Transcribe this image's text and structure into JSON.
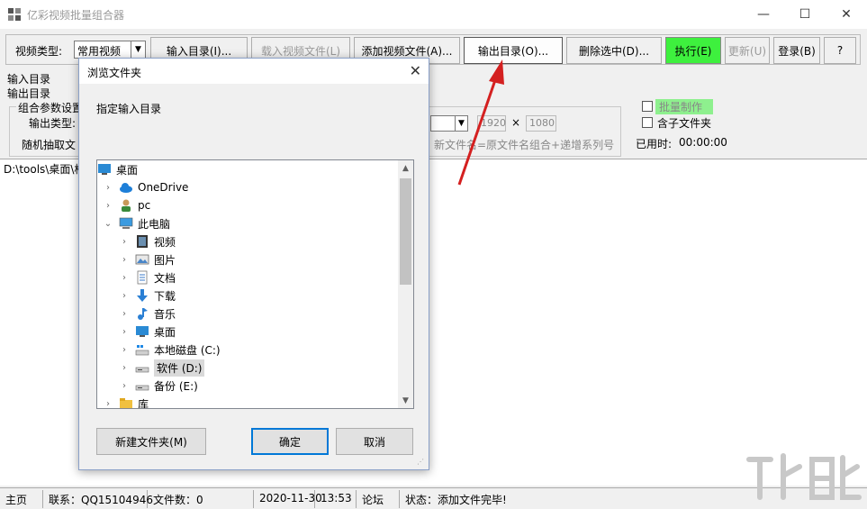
{
  "window": {
    "title": "亿彩视频批量组合器",
    "controls": {
      "minimize": "—",
      "maximize": "☐",
      "close": "✕"
    }
  },
  "toolbar": {
    "video_type_label": "视频类型:",
    "video_type_value": "常用视频",
    "buttons": {
      "input_dir": "输入目录(I)...",
      "load_files": "载入视频文件(L)",
      "add_files": "添加视频文件(A)...",
      "output_dir": "输出目录(O)...",
      "delete_selected": "删除选中(D)...",
      "execute": "执行(E)",
      "update": "更新(U)",
      "login": "登录(B)",
      "help": "?"
    }
  },
  "form": {
    "input_dir_label": "输入目录",
    "output_dir_label": "输出目录",
    "group_label": "组合参数设置",
    "output_type_label": "输出类型:",
    "random_label": "随机抽取文",
    "width": "1920",
    "times": "×",
    "height": "1080",
    "naming_hint": "新文件名=原文件名组合+递增系列号",
    "batch_label": "批量制作",
    "subfolder_label": "含子文件夹",
    "elapsed_label": "已用时:",
    "elapsed_value": "00:00:00"
  },
  "list": {
    "path": "D:\\tools\\桌面\\格"
  },
  "status": {
    "home": "主页",
    "contact": "联系：QQ15104946",
    "file_count": "文件数：0",
    "date": "2020-11-30",
    "time": "13:53",
    "forum": "论坛",
    "state": "状态：添加文件完毕!"
  },
  "dialog": {
    "title": "浏览文件夹",
    "description": "指定输入目录",
    "tree": [
      {
        "label": "桌面",
        "icon": "desktop-icon"
      },
      {
        "label": "OneDrive",
        "icon": "cloud-icon"
      },
      {
        "label": "pc",
        "icon": "user-icon"
      },
      {
        "label": "此电脑",
        "icon": "computer-icon"
      },
      {
        "label": "视频",
        "icon": "video-icon"
      },
      {
        "label": "图片",
        "icon": "picture-icon"
      },
      {
        "label": "文档",
        "icon": "document-icon"
      },
      {
        "label": "下载",
        "icon": "download-icon"
      },
      {
        "label": "音乐",
        "icon": "music-icon"
      },
      {
        "label": "桌面",
        "icon": "desktop-icon"
      },
      {
        "label": "本地磁盘 (C:)",
        "icon": "system-drive-icon"
      },
      {
        "label": "软件 (D:)",
        "icon": "drive-icon"
      },
      {
        "label": "备份 (E:)",
        "icon": "drive-icon"
      },
      {
        "label": "库",
        "icon": "library-icon"
      }
    ],
    "buttons": {
      "new_folder": "新建文件夹(M)",
      "ok": "确定",
      "cancel": "取消"
    }
  },
  "colors": {
    "execute_green": "#3ef03e",
    "arrow_red": "#d42020",
    "selection": "#d9d9d9"
  }
}
